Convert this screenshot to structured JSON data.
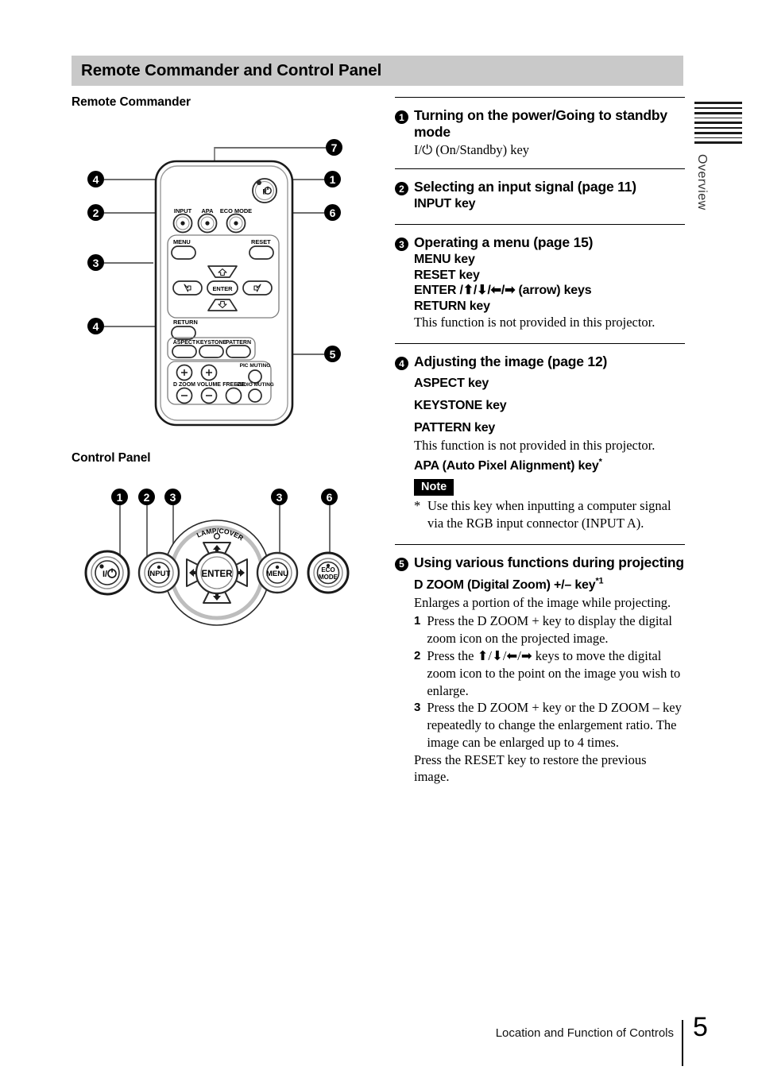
{
  "section": {
    "title": "Remote Commander and Control Panel"
  },
  "left": {
    "remote_heading": "Remote Commander",
    "control_heading": "Control Panel",
    "remote_callouts": [
      "7",
      "4",
      "1",
      "2",
      "6",
      "3",
      "4",
      "5"
    ],
    "remote_labels": {
      "power": "I/↑",
      "input": "INPUT",
      "apa": "APA",
      "eco_mode": "ECO MODE",
      "menu": "MENU",
      "reset": "RESET",
      "enter": "ENTER",
      "return": "RETURN",
      "aspect": "ASPECT",
      "keystone": "KEYSTONE",
      "pattern": "PATTERN",
      "pic_muting": "PIC MUTING",
      "d_zoom": "D ZOOM",
      "volume": "VOLUME",
      "freeze": "FREEZE",
      "audio_muting": "AUDIO MUTING",
      "plus": "+",
      "minus": "−"
    },
    "panel_callouts": [
      "1",
      "2",
      "3",
      "3",
      "6"
    ],
    "panel_labels": {
      "power": "I/",
      "input": "INPUT",
      "enter": "ENTER",
      "menu": "MENU",
      "eco_line1": "ECO",
      "eco_line2": "MODE",
      "lamp_cover": "LAMP/COVER"
    }
  },
  "right": {
    "blocks": [
      {
        "num": "1",
        "heading": "Turning on the power/Going to standby mode",
        "lines": [
          {
            "type": "serif",
            "text": "I/⏻ (On/Standby) key"
          }
        ]
      },
      {
        "num": "2",
        "heading": "Selecting an input signal (page 11)",
        "lines": [
          {
            "type": "bold",
            "text": "INPUT key"
          }
        ]
      },
      {
        "num": "3",
        "heading": "Operating a menu (page 15)",
        "lines": [
          {
            "type": "bold",
            "text": "MENU key"
          },
          {
            "type": "bold",
            "text": "RESET key"
          },
          {
            "type": "bold",
            "text": "ENTER /⬆/⬇/⬅/➡ (arrow) keys"
          },
          {
            "type": "bold",
            "text": "RETURN key"
          },
          {
            "type": "serif",
            "text": "This function is not provided in this projector."
          }
        ]
      },
      {
        "num": "4",
        "heading": "Adjusting the image (page 12)",
        "lines": [
          {
            "type": "bold-sp",
            "text": "ASPECT key"
          },
          {
            "type": "bold-sp",
            "text": "KEYSTONE key"
          },
          {
            "type": "bold-sp",
            "text": "PATTERN key"
          },
          {
            "type": "serif",
            "text": "This function is not provided in this projector."
          },
          {
            "type": "bold-sup",
            "text": "APA (Auto Pixel Alignment) key",
            "sup": "*"
          }
        ],
        "note": {
          "badge": "Note",
          "star": "*",
          "text": "Use this key when inputting a computer signal via the RGB input connector (INPUT A)."
        }
      },
      {
        "num": "5",
        "heading": "Using various functions during projecting",
        "lines": [
          {
            "type": "bold-sup",
            "text": "D ZOOM (Digital Zoom) +/– key",
            "sup": "*1"
          },
          {
            "type": "serif",
            "text": "Enlarges a portion of the image while projecting."
          }
        ],
        "steps": [
          {
            "n": "1",
            "text": "Press the D ZOOM + key to display the digital zoom icon on the projected image."
          },
          {
            "n": "2",
            "text": "Press the ⬆/⬇/⬅/➡ keys to move the digital zoom icon to the point on the image  you wish to enlarge."
          },
          {
            "n": "3",
            "text": "Press the D ZOOM + key or the D ZOOM – key repeatedly to change the enlargement ratio. The image can be enlarged up to 4 times."
          }
        ],
        "tail": "Press the RESET key to restore the previous image."
      }
    ]
  },
  "edge_tab": {
    "label": "Overview"
  },
  "footer": {
    "text": "Location and Function of Controls",
    "page": "5"
  }
}
